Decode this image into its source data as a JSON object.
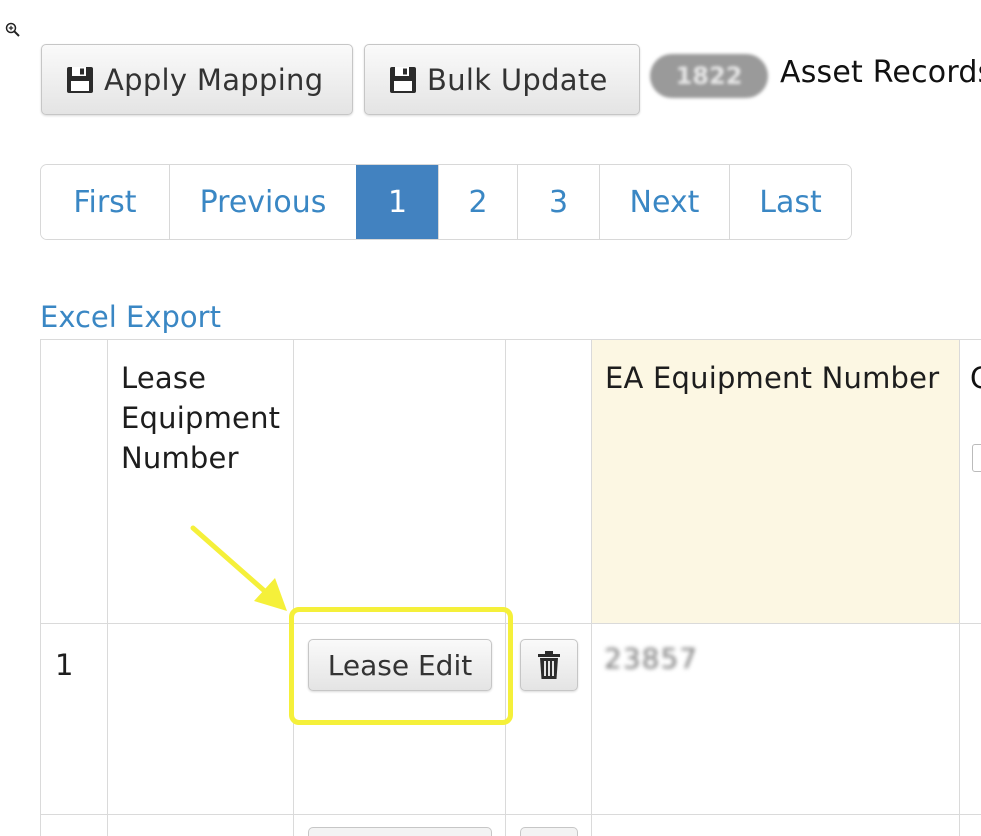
{
  "toolbar": {
    "apply_mapping_label": "Apply Mapping",
    "bulk_update_label": "Bulk Update",
    "record_count": "1822",
    "records_label": "Asset Records"
  },
  "pagination": {
    "first": "First",
    "previous": "Previous",
    "pages": [
      "1",
      "2",
      "3"
    ],
    "current_page": "1",
    "next": "Next",
    "last": "Last"
  },
  "excel_export_label": "Excel Export",
  "table": {
    "headers": {
      "lease_equipment_number": "Lease Equipment Number",
      "ea_equipment_number": "EA Equipment Number",
      "next_column_partial": "C A"
    },
    "rows": [
      {
        "index": "1",
        "lease_equipment_number": "",
        "lease_edit_label": "Lease Edit",
        "ea_equipment_number": "23857"
      }
    ]
  },
  "annotation": {
    "arrow_color": "#f5f03a",
    "highlight_color": "#f5f03a"
  },
  "colors": {
    "link": "#3a87c4",
    "active_page": "#4282c0",
    "ea_header_bg": "#fcf7e3",
    "badge": "#9a9a9a"
  },
  "icons": {
    "zoom": "zoom-in-icon",
    "save": "floppy-disk-icon",
    "delete": "trash-icon"
  }
}
